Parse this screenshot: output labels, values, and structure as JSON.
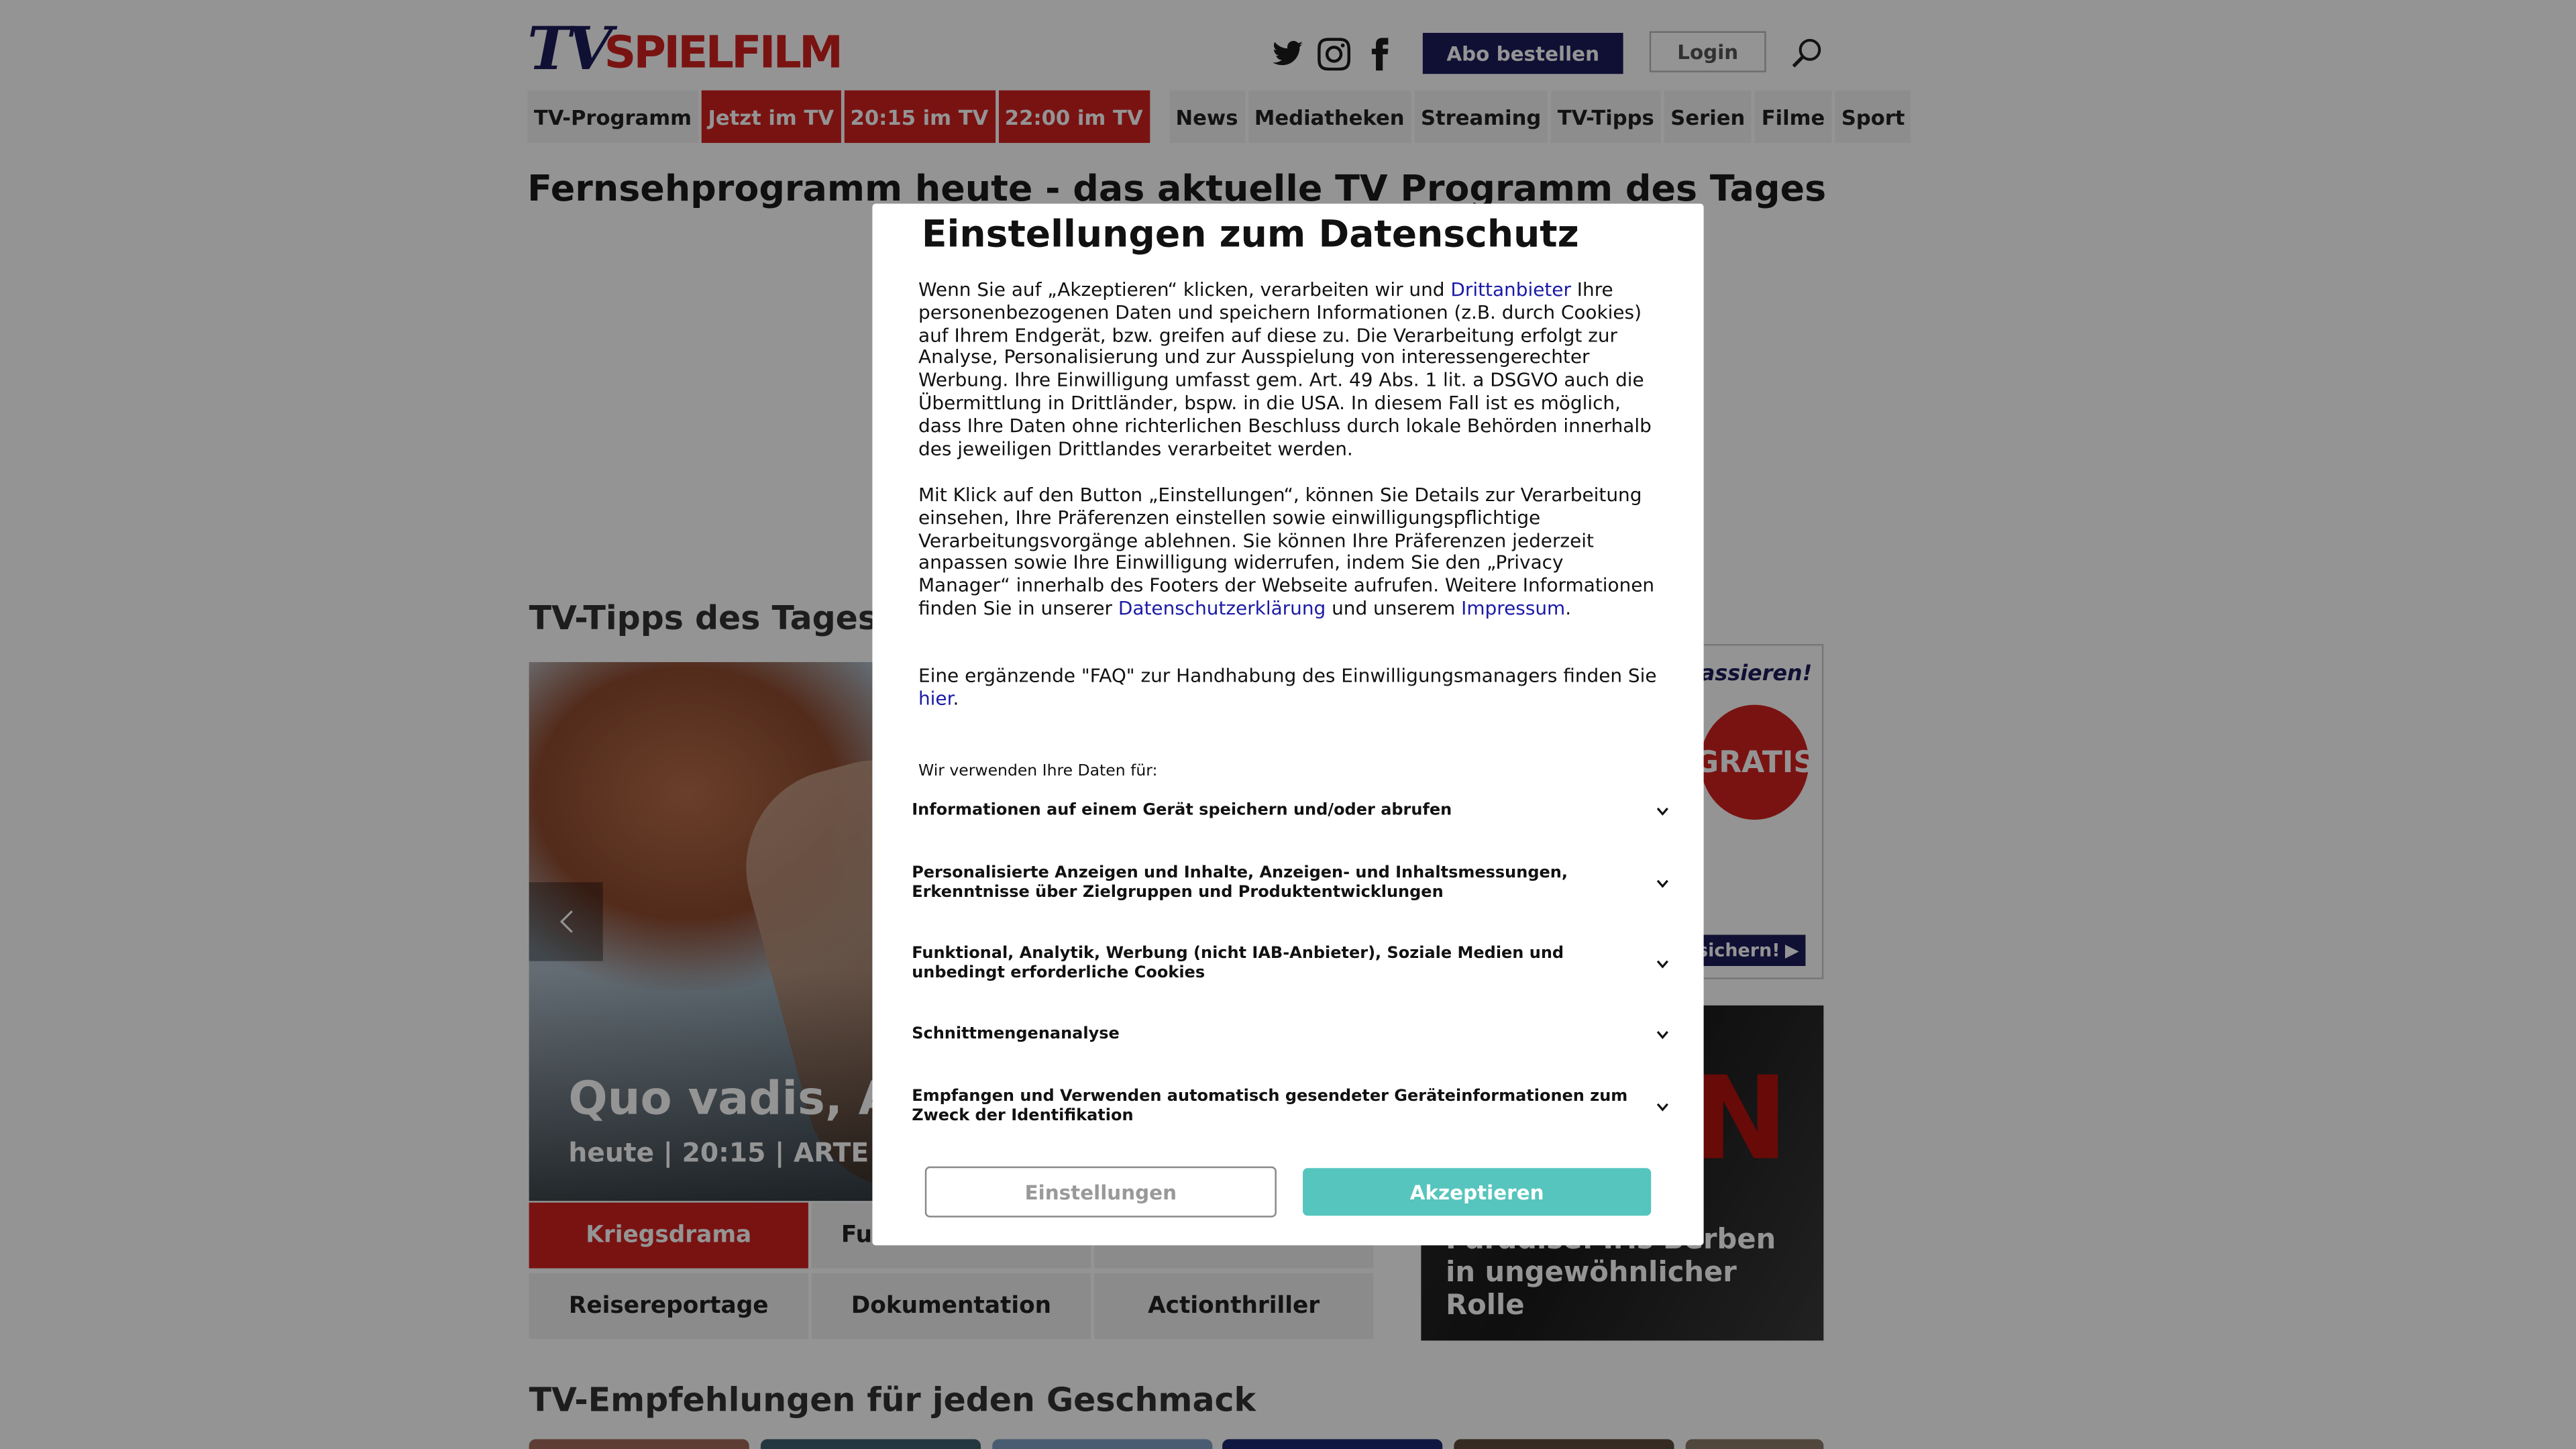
{
  "header": {
    "logo_tv": "TV",
    "logo_spielfilm": "SPIELFILM",
    "abo_label": "Abo bestellen",
    "login_label": "Login"
  },
  "nav": {
    "items": [
      {
        "label": "TV-Programm"
      },
      {
        "label": "Jetzt im TV"
      },
      {
        "label": "20:15 im TV"
      },
      {
        "label": "22:00 im TV"
      },
      {
        "label": "News"
      },
      {
        "label": "Mediatheken"
      },
      {
        "label": "Streaming"
      },
      {
        "label": "TV-Tipps"
      },
      {
        "label": "Serien"
      },
      {
        "label": "Filme"
      },
      {
        "label": "Sport"
      }
    ]
  },
  "page_title": "Fernsehprogramm heute - das aktuelle TV Programm des Tages",
  "tips": {
    "title": "TV-Tipps des Tages",
    "hero_title": "Quo vadis, A",
    "hero_meta": "heute | 20:15 | ARTE |",
    "genres": [
      {
        "label": "Kriegsdrama"
      },
      {
        "label": "Fu"
      },
      {
        "label": "Reisereportage"
      },
      {
        "label": "Dokumentation"
      },
      {
        "label": "Actionthriller"
      }
    ]
  },
  "ads": {
    "ad1_tagline": "ein kassieren!",
    "ad1_badge": "GRATIS",
    "ad1_button": "sichern!",
    "ad2_letter": "N",
    "ad2_text": "Paradise: Iris Berben in ungewöhnlicher Rolle"
  },
  "recommendations_title": "TV-Empfehlungen für jeden Geschmack",
  "modal": {
    "title": "Einstellungen zum Datenschutz",
    "p1_before": "Wenn Sie auf „Akzeptieren“ klicken, verarbeiten wir und ",
    "p1_link": "Drittanbieter",
    "p1_after": " Ihre personenbezogenen Daten und speichern Informationen (z.B. durch Cookies) auf Ihrem Endgerät, bzw. greifen auf diese zu. Die Verarbeitung erfolgt zur Analyse, Personalisierung und zur Ausspielung von interessengerechter Werbung. Ihre Einwilligung umfasst gem. Art. 49 Abs. 1 lit. a DSGVO auch die Übermittlung in Drittländer, bspw. in die USA. In diesem Fall ist es möglich, dass Ihre Daten ohne richterlichen Beschluss durch lokale Behörden innerhalb des jeweiligen Drittlandes verarbeitet werden.",
    "p2_before": "Mit Klick auf den Button „Einstellungen“, können Sie Details zur Verarbeitung einsehen, Ihre Präferenzen einstellen sowie einwilligungspflichtige Verarbeitungsvorgänge ablehnen. Sie können Ihre Präferenzen jederzeit anpassen sowie Ihre Einwilligung widerrufen, indem Sie den „Privacy Manager“ innerhalb des Footers der Webseite aufrufen. Weitere Informationen finden Sie in unserer ",
    "p2_link1": "Datenschutzerklärung",
    "p2_mid": " und unserem ",
    "p2_link2": "Impressum",
    "p2_end": ".",
    "p3_text": "Eine ergänzende \"FAQ\" zur Handhabung des Einwilligungsmanagers finden Sie",
    "p3_link": "hier",
    "p3_end": ".",
    "purposes_label": "Wir verwenden Ihre Daten für:",
    "purposes": [
      {
        "label": "Informationen auf einem Gerät speichern und/oder abrufen"
      },
      {
        "label": "Personalisierte Anzeigen und Inhalte, Anzeigen- und Inhaltsmessungen, Erkenntnisse über Zielgruppen und Produktentwicklungen"
      },
      {
        "label": "Funktional, Analytik, Werbung (nicht IAB-Anbieter), Soziale Medien und unbedingt erforderliche Cookies"
      },
      {
        "label": "Schnittmengenanalyse"
      },
      {
        "label": "Empfangen und Verwenden automatisch gesendeter Geräteinformationen zum Zweck der Identifikation"
      }
    ],
    "settings_label": "Einstellungen",
    "accept_label": "Akzeptieren",
    "accept_color": "#55c5bd"
  }
}
